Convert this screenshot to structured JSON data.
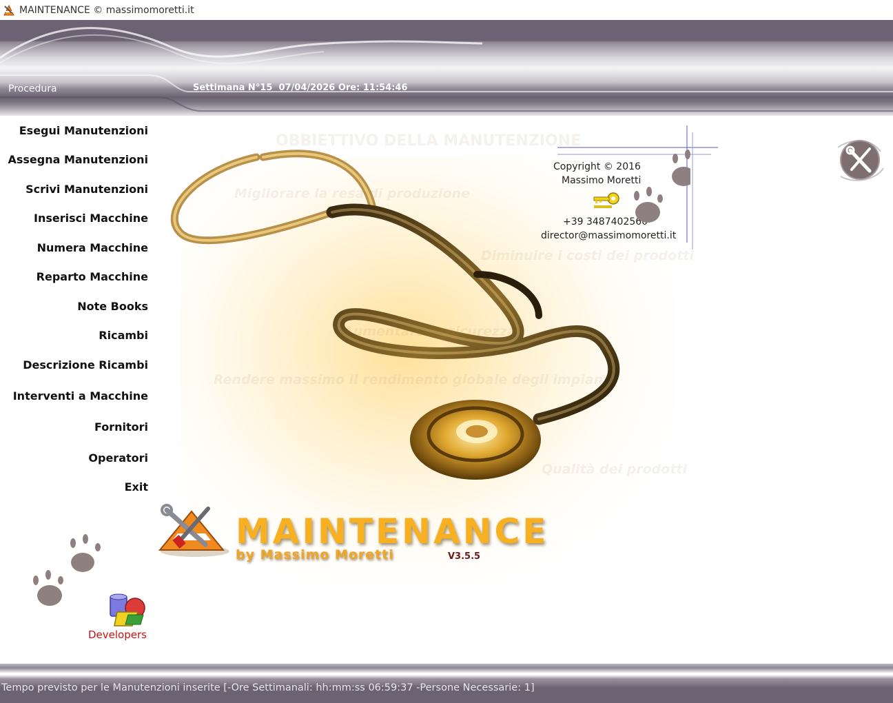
{
  "window": {
    "title": "MAINTENANCE © massimomoretti.it",
    "app_icon": "maintenance-cone-icon"
  },
  "header": {
    "section_label": "Procedura",
    "week_info": "Settimana N°15  07/04/2026 Ore: 11:54:46"
  },
  "menu": {
    "items": [
      {
        "label": "Esegui Manutenzioni"
      },
      {
        "label": "Assegna Manutenzioni"
      },
      {
        "label": "Scrivi Manutenzioni"
      },
      {
        "label": "Inserisci Macchine"
      },
      {
        "label": "Numera Macchine"
      },
      {
        "label": "Reparto Macchine"
      },
      {
        "label": "Note Books"
      },
      {
        "label": "Ricambi"
      },
      {
        "label": "Descrizione Ricambi"
      },
      {
        "label": "Interventi a Macchine"
      },
      {
        "label": "Fornitori"
      },
      {
        "label": "Operatori"
      },
      {
        "label": "Exit"
      }
    ]
  },
  "watermark": {
    "title": "OBBIETTIVO DELLA MANUTENZIONE",
    "lines": [
      "Migliorare la resa di produzione",
      "Diminuire i costi dei prodotti",
      "Aumentare la sicurezza",
      "Rendere massimo il rendimento globale degli impianti",
      "Qualità dei prodotti"
    ]
  },
  "copyright": {
    "line1": "Copyright ©   2016",
    "line2": "Massimo Moretti",
    "phone": "+39 3487402560",
    "email": "director@massimomoretti.it"
  },
  "logo": {
    "name": "MAINTENANCE",
    "byline": "by Massimo Moretti",
    "version": "V3.5.5"
  },
  "developers_label": "Developers",
  "status": {
    "text": "Tempo previsto per le Manutenzioni inserite [-Ore Settimanali: hh:mm:ss 06:59:37 -Persone Necessarie: 1]"
  },
  "colors": {
    "header_purple": "#6b6373",
    "logo_orange": "#f6b021",
    "developers_red": "#cc1111"
  }
}
